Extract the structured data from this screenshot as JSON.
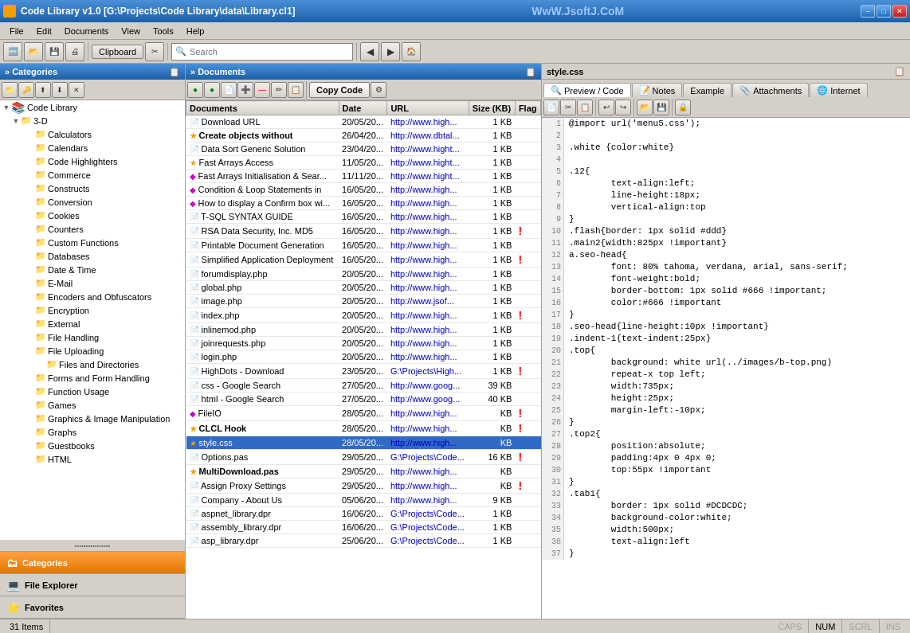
{
  "titlebar": {
    "title": "Code Library v1.0 [G:\\Projects\\Code Library\\data\\Library.cl1]",
    "watermark": "WwW.JsoftJ.CoM",
    "min_label": "–",
    "max_label": "□",
    "close_label": "✕"
  },
  "menubar": {
    "items": [
      "File",
      "Edit",
      "Documents",
      "View",
      "Tools",
      "Help"
    ]
  },
  "toolbar": {
    "clipboard_label": "Clipboard",
    "search_placeholder": "Search"
  },
  "left_panel": {
    "header": "» Categories",
    "tree": [
      {
        "label": "Code Library",
        "level": 0,
        "expand": true,
        "type": "root"
      },
      {
        "label": "3-D",
        "level": 1,
        "expand": true,
        "type": "folder"
      },
      {
        "label": "Calculators",
        "level": 2,
        "type": "folder"
      },
      {
        "label": "Calendars",
        "level": 2,
        "type": "folder"
      },
      {
        "label": "Code Highlighters",
        "level": 2,
        "type": "folder"
      },
      {
        "label": "Commerce",
        "level": 2,
        "type": "folder"
      },
      {
        "label": "Constructs",
        "level": 2,
        "type": "folder"
      },
      {
        "label": "Conversion",
        "level": 2,
        "type": "folder"
      },
      {
        "label": "Cookies",
        "level": 2,
        "type": "folder"
      },
      {
        "label": "Counters",
        "level": 2,
        "type": "folder"
      },
      {
        "label": "Custom Functions",
        "level": 2,
        "type": "folder"
      },
      {
        "label": "Databases",
        "level": 2,
        "type": "folder"
      },
      {
        "label": "Date & Time",
        "level": 2,
        "type": "folder"
      },
      {
        "label": "E-Mail",
        "level": 2,
        "type": "folder"
      },
      {
        "label": "Encoders and Obfuscators",
        "level": 2,
        "type": "folder"
      },
      {
        "label": "Encryption",
        "level": 2,
        "type": "folder"
      },
      {
        "label": "External",
        "level": 2,
        "type": "folder"
      },
      {
        "label": "File Handling",
        "level": 2,
        "type": "folder"
      },
      {
        "label": "File Uploading",
        "level": 2,
        "type": "folder"
      },
      {
        "label": "Files and Directories",
        "level": 3,
        "type": "folder"
      },
      {
        "label": "Forms and Form Handling",
        "level": 2,
        "type": "folder"
      },
      {
        "label": "Function Usage",
        "level": 2,
        "type": "folder"
      },
      {
        "label": "Games",
        "level": 2,
        "type": "folder"
      },
      {
        "label": "Graphics & Image Manipulation",
        "level": 2,
        "type": "folder"
      },
      {
        "label": "Graphs",
        "level": 2,
        "type": "folder"
      },
      {
        "label": "Guestbooks",
        "level": 2,
        "type": "folder"
      },
      {
        "label": "HTML",
        "level": 2,
        "type": "folder"
      }
    ],
    "bottom_buttons": [
      {
        "label": "Categories",
        "active": true,
        "icon": "🗂"
      },
      {
        "label": "File Explorer",
        "active": false,
        "icon": "💻"
      },
      {
        "label": "Favorites",
        "active": false,
        "icon": "⭐"
      }
    ]
  },
  "mid_panel": {
    "header": "» Documents",
    "columns": [
      "Documents",
      "Date",
      "URL",
      "Size (KB)",
      "Flag"
    ],
    "copy_code_label": "Copy Code",
    "rows": [
      {
        "name": "Download URL",
        "date": "20/05/20...",
        "url": "http://www.high...",
        "size": "1 KB",
        "flag": "",
        "icon": "doc"
      },
      {
        "name": "Create objects without",
        "date": "26/04/20...",
        "url": "http://www.dbtal...",
        "size": "1 KB",
        "flag": "",
        "icon": "star",
        "bold": true
      },
      {
        "name": "Data Sort Generic Solution",
        "date": "23/04/20...",
        "url": "http://www.hight...",
        "size": "1 KB",
        "flag": "",
        "icon": "doc"
      },
      {
        "name": "Fast Arrays Access",
        "date": "11/05/20...",
        "url": "http://www.hight...",
        "size": "1 KB",
        "flag": "",
        "icon": "star"
      },
      {
        "name": "Fast Arrays Initialisation & Sear...",
        "date": "11/11/20...",
        "url": "http://www.hight...",
        "size": "1 KB",
        "flag": "",
        "icon": "diamond"
      },
      {
        "name": "Condition & Loop Statements in",
        "date": "16/05/20...",
        "url": "http://www.high...",
        "size": "1 KB",
        "flag": "",
        "icon": "diamond"
      },
      {
        "name": "How to display a Confirm box wi...",
        "date": "16/05/20...",
        "url": "http://www.high...",
        "size": "1 KB",
        "flag": "",
        "icon": "diamond"
      },
      {
        "name": "T-SQL SYNTAX GUIDE",
        "date": "16/05/20...",
        "url": "http://www.high...",
        "size": "1 KB",
        "flag": "",
        "icon": "doc"
      },
      {
        "name": "RSA Data Security, Inc. MD5",
        "date": "16/05/20...",
        "url": "http://www.high...",
        "size": "1 KB",
        "flag": "red",
        "icon": "doc"
      },
      {
        "name": "Printable Document Generation",
        "date": "16/05/20...",
        "url": "http://www.high...",
        "size": "1 KB",
        "flag": "",
        "icon": "doc"
      },
      {
        "name": "Simplified Application Deployment",
        "date": "16/05/20...",
        "url": "http://www.high...",
        "size": "1 KB",
        "flag": "red",
        "icon": "doc"
      },
      {
        "name": "forumdisplay.php",
        "date": "20/05/20...",
        "url": "http://www.high...",
        "size": "1 KB",
        "flag": "",
        "icon": "doc"
      },
      {
        "name": "global.php",
        "date": "20/05/20...",
        "url": "http://www.high...",
        "size": "1 KB",
        "flag": "",
        "icon": "doc"
      },
      {
        "name": "image.php",
        "date": "20/05/20...",
        "url": "http://www.jsof...",
        "size": "1 KB",
        "flag": "",
        "icon": "doc"
      },
      {
        "name": "index.php",
        "date": "20/05/20...",
        "url": "http://www.high...",
        "size": "1 KB",
        "flag": "red",
        "icon": "doc"
      },
      {
        "name": "inlinemod.php",
        "date": "20/05/20...",
        "url": "http://www.high...",
        "size": "1 KB",
        "flag": "",
        "icon": "doc"
      },
      {
        "name": "joinrequests.php",
        "date": "20/05/20...",
        "url": "http://www.high...",
        "size": "1 KB",
        "flag": "",
        "icon": "doc"
      },
      {
        "name": "login.php",
        "date": "20/05/20...",
        "url": "http://www.high...",
        "size": "1 KB",
        "flag": "",
        "icon": "doc"
      },
      {
        "name": "HighDots - Download",
        "date": "23/05/20...",
        "url": "G:\\Projects\\High...",
        "size": "1 KB",
        "flag": "red",
        "icon": "doc"
      },
      {
        "name": "css - Google Search",
        "date": "27/05/20...",
        "url": "http://www.goog...",
        "size": "39 KB",
        "flag": "",
        "icon": "doc"
      },
      {
        "name": "html - Google Search",
        "date": "27/05/20...",
        "url": "http://www.goog...",
        "size": "40 KB",
        "flag": "",
        "icon": "doc"
      },
      {
        "name": "FileIO",
        "date": "28/05/20...",
        "url": "http://www.high...",
        "size": "KB",
        "flag": "red",
        "icon": "diamond"
      },
      {
        "name": "CLCL Hook",
        "date": "28/05/20...",
        "url": "http://www.high...",
        "size": "KB",
        "flag": "red",
        "icon": "star",
        "bold": true
      },
      {
        "name": "style.css",
        "date": "28/05/20...",
        "url": "http://www.high...",
        "size": "KB",
        "flag": "",
        "icon": "star",
        "selected": true
      },
      {
        "name": "Options.pas",
        "date": "29/05/20...",
        "url": "G:\\Projects\\Code...",
        "size": "16 KB",
        "flag": "red",
        "icon": "doc"
      },
      {
        "name": "MultiDownload.pas",
        "date": "29/05/20...",
        "url": "http://www.high...",
        "size": "KB",
        "flag": "",
        "icon": "star",
        "bold": true
      },
      {
        "name": "Assign Proxy Settings",
        "date": "29/05/20...",
        "url": "http://www.high...",
        "size": "KB",
        "flag": "red",
        "icon": "doc"
      },
      {
        "name": "Company - About Us",
        "date": "05/06/20...",
        "url": "http://www.high...",
        "size": "9 KB",
        "flag": "",
        "icon": "doc"
      },
      {
        "name": "aspnet_library.dpr",
        "date": "16/06/20...",
        "url": "G:\\Projects\\Code...",
        "size": "1 KB",
        "flag": "",
        "icon": "doc"
      },
      {
        "name": "assembly_library.dpr",
        "date": "16/06/20...",
        "url": "G:\\Projects\\Code...",
        "size": "1 KB",
        "flag": "",
        "icon": "doc"
      },
      {
        "name": "asp_library.dpr",
        "date": "25/06/20...",
        "url": "G:\\Projects\\Code...",
        "size": "1 KB",
        "flag": "",
        "icon": "doc"
      }
    ]
  },
  "right_panel": {
    "filename": "style.css",
    "tabs": [
      "Preview / Code",
      "Notes",
      "Example",
      "Attachments",
      "Internet"
    ],
    "code_lines": [
      {
        "num": 1,
        "content": "@import url('menu5.css');"
      },
      {
        "num": 2,
        "content": ""
      },
      {
        "num": 3,
        "content": ".white {color:white}"
      },
      {
        "num": 4,
        "content": ""
      },
      {
        "num": 5,
        "content": ".12{"
      },
      {
        "num": 6,
        "content": "        text-align:left;"
      },
      {
        "num": 7,
        "content": "        line-height:18px;"
      },
      {
        "num": 8,
        "content": "        vertical-align:top"
      },
      {
        "num": 9,
        "content": "}"
      },
      {
        "num": 10,
        "content": ".flash{border: 1px solid #ddd}"
      },
      {
        "num": 11,
        "content": ".main2{width:825px !important}"
      },
      {
        "num": 12,
        "content": "a.seo-head{"
      },
      {
        "num": 13,
        "content": "        font: 80% tahoma, verdana, arial, sans-serif;"
      },
      {
        "num": 14,
        "content": "        font-weight:bold;"
      },
      {
        "num": 15,
        "content": "        border-bottom: 1px solid #666 !important;"
      },
      {
        "num": 16,
        "content": "        color:#666 !important"
      },
      {
        "num": 17,
        "content": "}"
      },
      {
        "num": 18,
        "content": ".seo-head{line-height:10px !important}"
      },
      {
        "num": 19,
        "content": ".indent-1{text-indent:25px}"
      },
      {
        "num": 20,
        "content": ".top{"
      },
      {
        "num": 21,
        "content": "        background: white url(../images/b-top.png)"
      },
      {
        "num": 22,
        "content": "        repeat-x top left;"
      },
      {
        "num": 23,
        "content": "        width:735px;"
      },
      {
        "num": 24,
        "content": "        height:25px;"
      },
      {
        "num": 25,
        "content": "        margin-left:-10px;"
      },
      {
        "num": 26,
        "content": "}"
      },
      {
        "num": 27,
        "content": ".top2{"
      },
      {
        "num": 28,
        "content": "        position:absolute;"
      },
      {
        "num": 29,
        "content": "        padding:4px 0 4px 0;"
      },
      {
        "num": 30,
        "content": "        top:55px !important"
      },
      {
        "num": 31,
        "content": "}"
      },
      {
        "num": 32,
        "content": ".tab1{"
      },
      {
        "num": 33,
        "content": "        border: 1px solid #DCDCDC;"
      },
      {
        "num": 34,
        "content": "        background-color:white;"
      },
      {
        "num": 35,
        "content": "        width:500px;"
      },
      {
        "num": 36,
        "content": "        text-align:left"
      },
      {
        "num": 37,
        "content": "}"
      }
    ]
  },
  "statusbar": {
    "items_count": "31 Items",
    "caps": "CAPS",
    "num": "NUM",
    "scrl": "SCRL",
    "ins": "INS"
  }
}
